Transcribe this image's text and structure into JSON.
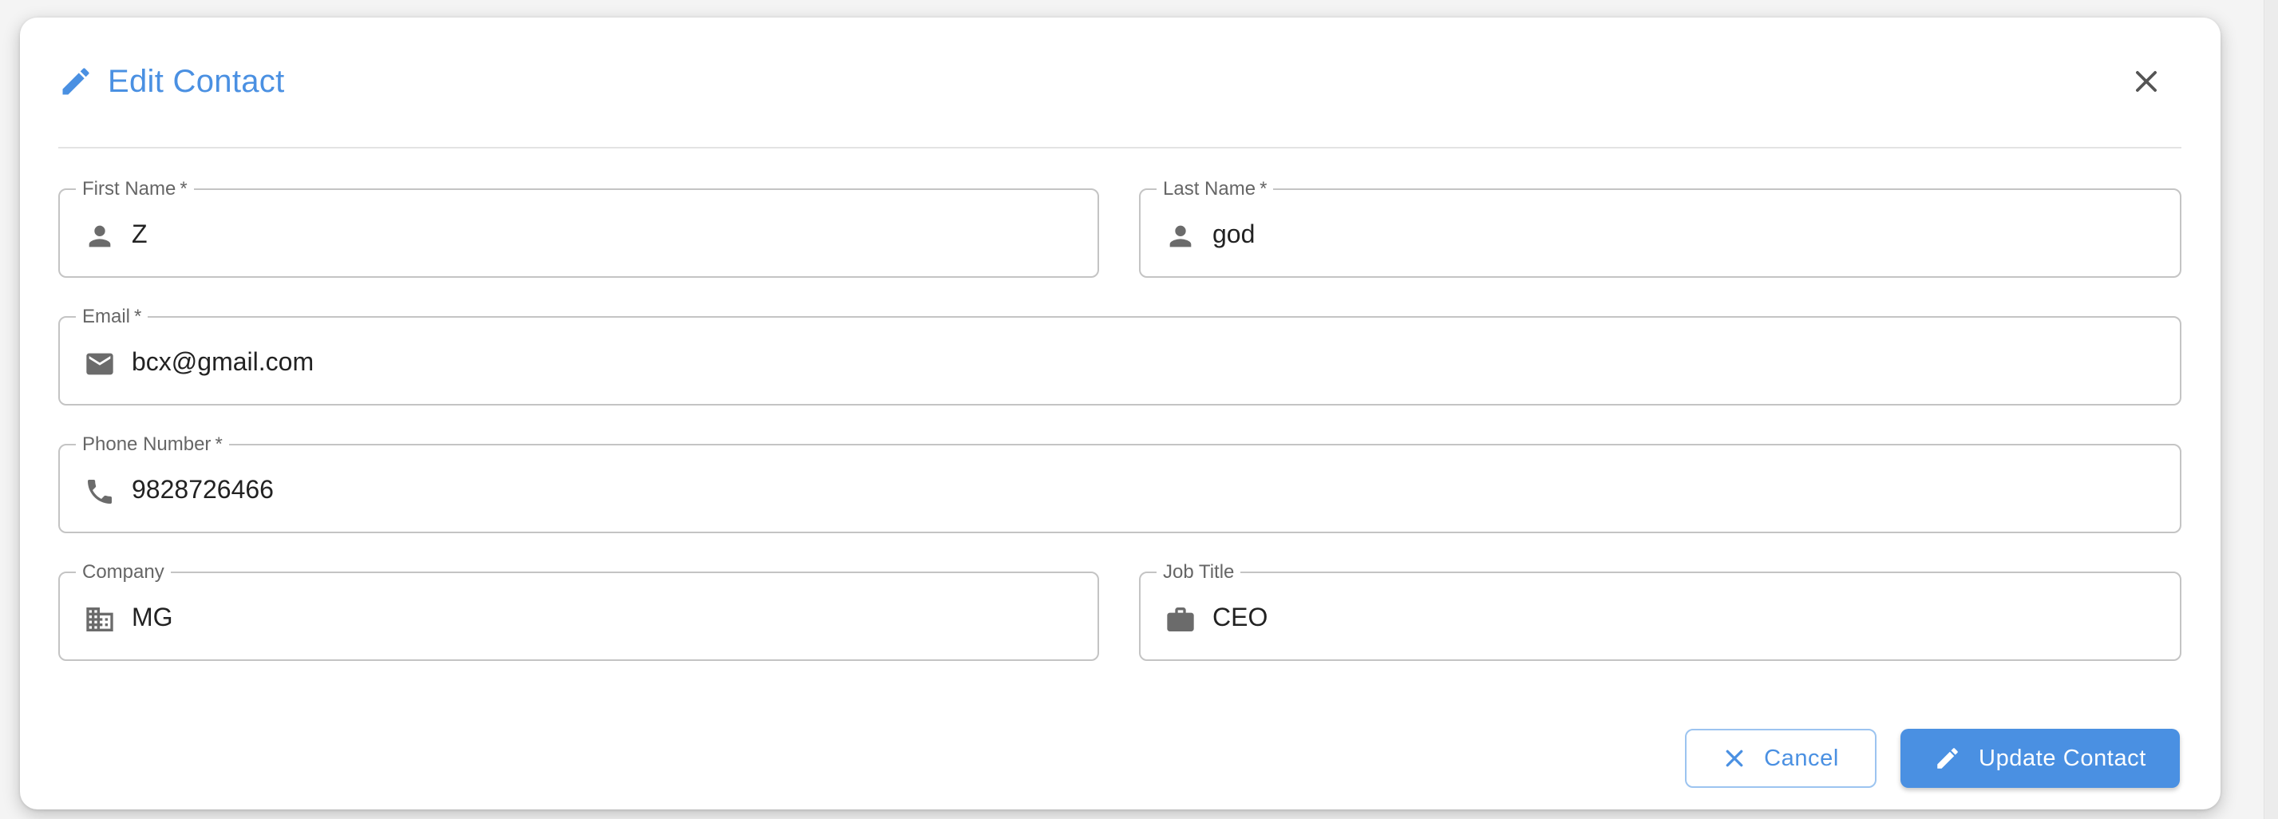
{
  "dialog": {
    "title": "Edit Contact",
    "title_icon": "pencil-icon",
    "close_icon": "close-icon"
  },
  "fields": {
    "first_name": {
      "label": "First Name",
      "required": "*",
      "value": "Z",
      "icon": "person-icon"
    },
    "last_name": {
      "label": "Last Name",
      "required": "*",
      "value": "god",
      "icon": "person-icon"
    },
    "email": {
      "label": "Email",
      "required": "*",
      "value": "bcx@gmail.com",
      "icon": "mail-icon"
    },
    "phone": {
      "label": "Phone Number",
      "required": "*",
      "value": "9828726466",
      "icon": "phone-icon"
    },
    "company": {
      "label": "Company",
      "value": "MG",
      "icon": "building-icon"
    },
    "job_title": {
      "label": "Job Title",
      "value": "CEO",
      "icon": "briefcase-icon"
    }
  },
  "actions": {
    "cancel_label": "Cancel",
    "update_label": "Update Contact"
  },
  "colors": {
    "accent": "#4a90e2",
    "border": "#c4c4c4",
    "icon": "#6b6b6b",
    "text": "#222222"
  }
}
